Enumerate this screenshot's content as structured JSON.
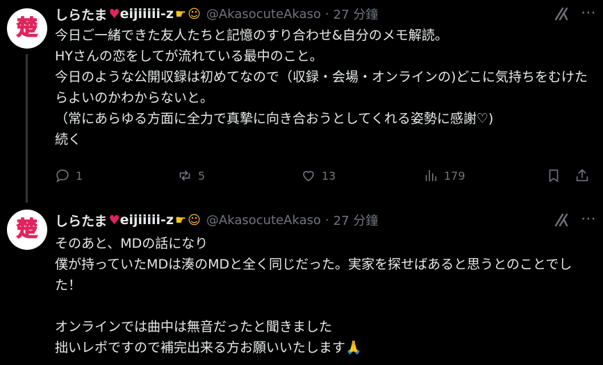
{
  "tweets": [
    {
      "author": {
        "name": "しらたま",
        "name_suffix": "eijiiiii-z",
        "handle": "@AkasocuteAkaso",
        "avatar_char": "楚"
      },
      "separator": "·",
      "time": "27 分鐘",
      "body": "今日ご一緒できた友人たちと記憶のすり合わせ&自分のメモ解読。\nHYさんの恋をしてが流れている最中のこと。\n今日のような公開収録は初めてなので（収録・会場・オンラインの)どこに気持ちをむけたらよいのかわからないと。\n（常にあらゆる方面に全力で真摯に向き合おうとしてくれる姿勢に感謝♡)\n続く",
      "stats": {
        "replies": "1",
        "reposts": "5",
        "likes": "13",
        "views": "179"
      }
    },
    {
      "author": {
        "name": "しらたま",
        "name_suffix": "eijiiiii-z",
        "handle": "@AkasocuteAkaso",
        "avatar_char": "楚"
      },
      "separator": "·",
      "time": "27 分鐘",
      "body": "そのあと、MDの話になり\n僕が持っていたMDは湊のMDと全く同じだった。実家を探せばあると思うとのことでした！\n\nオンラインでは曲中は無音だったと聞きました\n拙いレポですので補完出来る方お願いいたします🙏"
    }
  ],
  "icons": [
    "reply-icon",
    "repost-icon",
    "like-icon",
    "views-icon",
    "bookmark-icon",
    "share-icon",
    "grok-icon"
  ],
  "colors": {
    "background": "#000000",
    "text": "#e7e9ea",
    "muted": "#71767b",
    "heart": "#e0245e"
  }
}
